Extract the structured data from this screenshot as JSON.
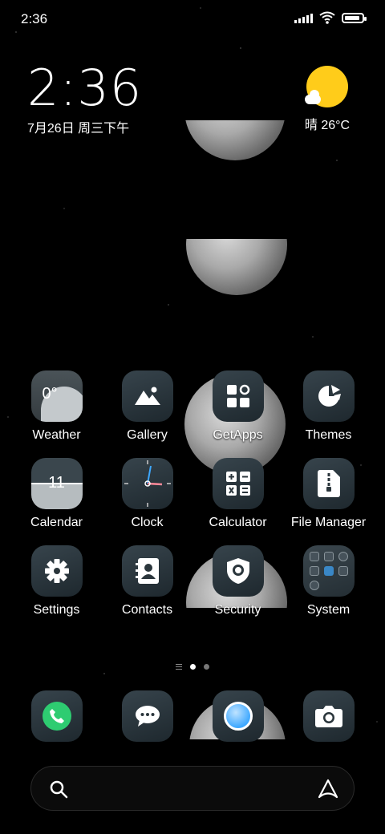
{
  "status_bar": {
    "time": "2:36",
    "icons": [
      "signal-icon",
      "wifi-icon",
      "battery-icon"
    ],
    "battery_level": 0.9
  },
  "clock_widget": {
    "time": "2:36",
    "date": "7月26日 周三下午"
  },
  "weather_widget": {
    "icon": "sun-cloud-icon",
    "text": "晴 26°C"
  },
  "apps": [
    {
      "label": "Weather",
      "icon": "weather-icon",
      "value": "0°"
    },
    {
      "label": "Gallery",
      "icon": "gallery-icon"
    },
    {
      "label": "GetApps",
      "icon": "getapps-icon"
    },
    {
      "label": "Themes",
      "icon": "themes-icon"
    },
    {
      "label": "Calendar",
      "icon": "calendar-icon",
      "value": "11"
    },
    {
      "label": "Clock",
      "icon": "clock-icon"
    },
    {
      "label": "Calculator",
      "icon": "calculator-icon"
    },
    {
      "label": "File Manager",
      "icon": "file-manager-icon"
    },
    {
      "label": "Settings",
      "icon": "gear-icon"
    },
    {
      "label": "Contacts",
      "icon": "contacts-icon"
    },
    {
      "label": "Security",
      "icon": "shield-icon"
    },
    {
      "label": "System",
      "icon": "system-folder-icon"
    }
  ],
  "page_indicator": {
    "pages": 2,
    "current": 1
  },
  "dock": [
    {
      "icon": "phone-icon"
    },
    {
      "icon": "messages-icon"
    },
    {
      "icon": "browser-icon"
    },
    {
      "icon": "camera-icon"
    }
  ],
  "search_bar": {
    "left_icon": "search-icon",
    "right_icon": "assistant-icon"
  },
  "colors": {
    "accent_sun": "#ffcc1a",
    "phone_green": "#2ecc71",
    "browser_blue": "#3ea8ff",
    "icon_bg": "#2b363c"
  }
}
